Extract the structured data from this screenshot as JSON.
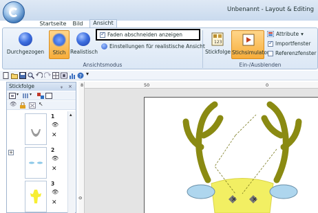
{
  "window": {
    "title": "Unbenannt - Layout & Editing"
  },
  "tabs": [
    {
      "label": "Startseite"
    },
    {
      "label": "Bild"
    },
    {
      "label": "Ansicht"
    }
  ],
  "ribbon": {
    "view_mode_group": {
      "label": "Ansichtsmodus",
      "buttons": [
        {
          "label": "Durchgezogen"
        },
        {
          "label": "Stich"
        },
        {
          "label": "Realistisch"
        }
      ],
      "options": [
        {
          "label": "Faden abschneiden anzeigen",
          "checked": true
        },
        {
          "label": "Einstellungen für realistische Ansicht"
        }
      ]
    },
    "show_hide_group": {
      "label": "Ein-/Ausblenden",
      "buttons": [
        {
          "label": "Stickfolge",
          "badge": "123"
        },
        {
          "label": "Stichsimulator"
        }
      ],
      "options": [
        {
          "label": "Attribute",
          "dropdown": true
        },
        {
          "label": "Importfenster",
          "checked": true
        },
        {
          "label": "Referenzfenster",
          "checked": false
        }
      ]
    }
  },
  "panel": {
    "title": "Stickfolge",
    "controls": {
      "pin": "ᵩ",
      "close": "×"
    },
    "items": [
      {
        "number": "1"
      },
      {
        "number": "2"
      },
      {
        "number": "3"
      }
    ]
  },
  "rulers": {
    "horizontal": [
      "8",
      "50",
      "0"
    ],
    "vertical": [
      "0"
    ]
  },
  "colors": {
    "accent_active": "#f7ad3a",
    "ribbon_bg": "#dbe7f5",
    "highlight_border": "#000000",
    "antler": "#8a8a12",
    "head": "#f2ef63",
    "ears": "#aed6ee"
  }
}
